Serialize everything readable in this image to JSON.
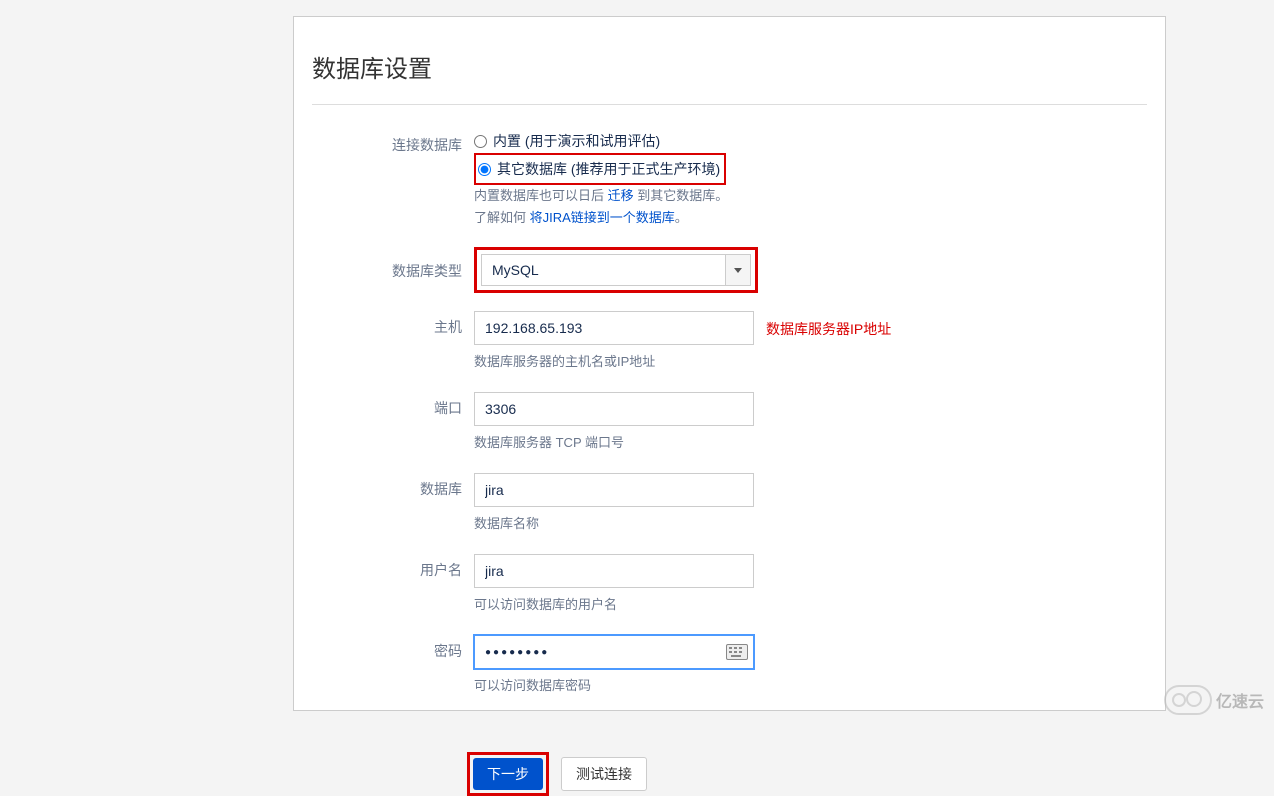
{
  "page": {
    "title": "数据库设置"
  },
  "form": {
    "connect_db": {
      "label": "连接数据库",
      "builtin_label": "内置 (用于演示和试用评估)",
      "other_label": "其它数据库 (推荐用于正式生产环境)",
      "help_prefix": "内置数据库也可以日后 ",
      "help_link1": "迁移",
      "help_mid": " 到其它数据库。",
      "help_prefix2": "了解如何 ",
      "help_link2": "将JIRA链接到一个数据库",
      "help_suffix2": "。"
    },
    "db_type": {
      "label": "数据库类型",
      "value": "MySQL"
    },
    "host": {
      "label": "主机",
      "value": "192.168.65.193",
      "annotation": "数据库服务器IP地址",
      "hint": "数据库服务器的主机名或IP地址"
    },
    "port": {
      "label": "端口",
      "value": "3306",
      "hint": "数据库服务器 TCP 端口号"
    },
    "database": {
      "label": "数据库",
      "value": "jira",
      "hint": "数据库名称"
    },
    "username": {
      "label": "用户名",
      "value": "jira",
      "hint": "可以访问数据库的用户名"
    },
    "password": {
      "label": "密码",
      "value": "●●●●●●●●",
      "hint": "可以访问数据库密码"
    }
  },
  "buttons": {
    "next": "下一步",
    "test": "测试连接"
  },
  "watermark": "亿速云"
}
